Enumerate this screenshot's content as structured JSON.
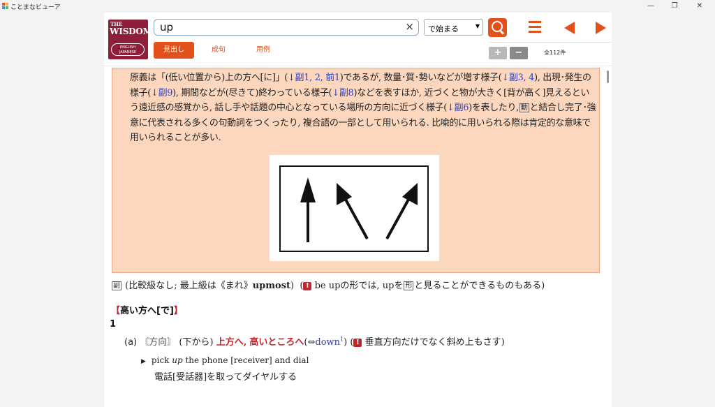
{
  "window": {
    "title": "ことまなビューア",
    "controls": {
      "minimize": "—",
      "maximize": "❐",
      "close": "✕"
    }
  },
  "logo": {
    "the": "THE",
    "wisdom": "WISDOM",
    "sub1": "ENGLISH",
    "sub2": "JAPANESE"
  },
  "search": {
    "value": "up",
    "clear": "×",
    "mode": "で始まる"
  },
  "tabs": [
    "見出し",
    "成句",
    "用例"
  ],
  "zoom": {
    "plus": "+",
    "minus": "−"
  },
  "result_count": "全112件",
  "entry": {
    "note": {
      "p1": "原義は「(低い位置から)上の方へ[に]」(",
      "r1": "↓副1, 2,",
      "r2": "前1",
      "p2": ")であるが, 数量･質･勢いなどが増す様子(",
      "r3": "↓副3, 4",
      "p3": "), 出現･発生の様子(",
      "r4": "↓副9",
      "p4": "), 期間などが(尽きて)終わっている様子(",
      "r5": "↓副8",
      "p5": ")などを表すほか, 近づくと物が大きく[背が高く]見えるという遠近感の感覚から, 話し手や話題の中心となっている場所の方向に近づく様子(",
      "r6": "↓副6",
      "p6": ")を表したり,",
      "box1": "動",
      "p7": "と結合し完了･強意に代表される多くの句動詞をつくったり, 複合語の一部として用いられる. 比喩的に用いられる際は肯定的な意味で用いられることが多い."
    },
    "pos_line": {
      "box": "副",
      "text1": "(比較級なし; 最上級は《まれ》",
      "upmost": "upmost",
      "text2": ")",
      "note_open": "(",
      "excl": "!",
      "note1": "be upの形では, upを",
      "box2": "形",
      "note2": "と見ることができるものもある)"
    },
    "sense_header": {
      "open": "【",
      "label": "高い方へ[で]",
      "close": "】"
    },
    "sense_num": "1",
    "sub_a": {
      "label": "(a)",
      "domain": "〘方向〙",
      "qualifier": "(下から)",
      "gloss1": "上方へ,",
      "gloss2": "高いところへ",
      "antonym_pre": "(⇔",
      "antonym": "down",
      "antonym_sup": "1",
      "antonym_post": ")",
      "note_open": "(",
      "excl": "!",
      "note": "垂直方向だけでなく斜め上もさす)"
    },
    "example1": {
      "marker": "▶",
      "en_pre": "pick ",
      "en_em": "up",
      "en_post": " the phone [receiver] and dial",
      "jp": "電話[受話器]を取ってダイヤルする"
    }
  },
  "colors": {
    "accent": "#e4501c",
    "note_bg": "#fcd6bd",
    "ref_blue": "#2a3fc4",
    "emphasis_red": "#c0272d",
    "logo_bg": "#8d1f3a"
  }
}
